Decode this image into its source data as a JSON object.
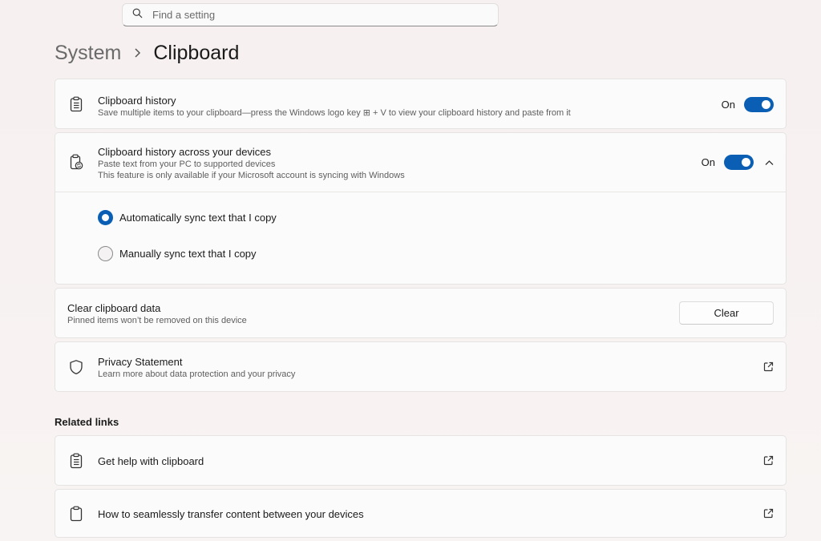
{
  "search": {
    "placeholder": "Find a setting",
    "icon": "search-icon"
  },
  "breadcrumb": {
    "parent": "System",
    "current": "Clipboard"
  },
  "settings": {
    "clipboard_history": {
      "title": "Clipboard history",
      "subtitle": "Save multiple items to your clipboard—press the Windows logo key ⊞ + V to view your clipboard history and paste from it",
      "state_label": "On",
      "enabled": true
    },
    "sync_devices": {
      "title": "Clipboard history across your devices",
      "subtitle_1": "Paste text from your PC to supported devices",
      "subtitle_2": "This feature is only available if your Microsoft account is syncing with Windows",
      "state_label": "On",
      "enabled": true,
      "expanded": true,
      "options": [
        {
          "label": "Automatically sync text that I copy",
          "selected": true
        },
        {
          "label": "Manually sync text that I copy",
          "selected": false
        }
      ]
    },
    "clear_data": {
      "title": "Clear clipboard data",
      "subtitle": "Pinned items won’t be removed on this device",
      "button_label": "Clear"
    },
    "privacy": {
      "title": "Privacy Statement",
      "subtitle": "Learn more about data protection and your privacy"
    }
  },
  "related": {
    "heading": "Related links",
    "links": [
      {
        "label": "Get help with clipboard"
      },
      {
        "label": "How to seamlessly transfer content between your devices"
      }
    ]
  },
  "colors": {
    "accent": "#0a5fb4",
    "background": "#f7f2f1",
    "card": "#fbfbfb"
  }
}
